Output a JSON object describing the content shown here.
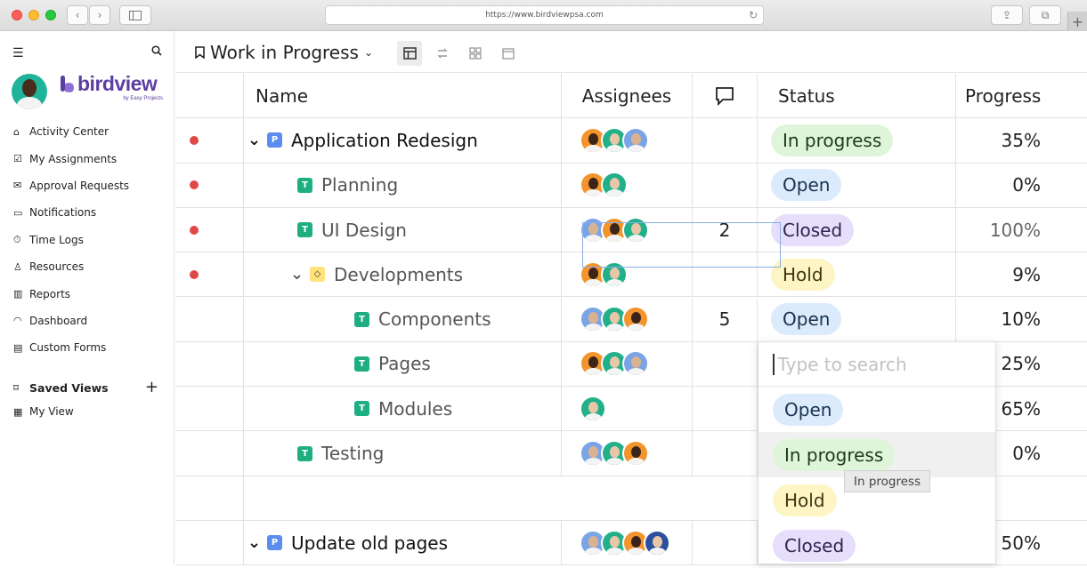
{
  "browser": {
    "url": "https://www.birdviewpsa.com",
    "back_glyph": "‹",
    "forward_glyph": "›",
    "reload_glyph": "↻",
    "share_glyph": "⇪",
    "tabs_glyph": "⧉",
    "new_tab_glyph": "+"
  },
  "brand": {
    "name": "birdview",
    "subtitle": "by Easy Projects",
    "color": "#5b3fa0"
  },
  "sidebar": {
    "items": [
      {
        "label": "Activity Center",
        "icon": "home-icon",
        "glyph": "⌂"
      },
      {
        "label": "My Assignments",
        "icon": "checkbox-icon",
        "glyph": "☑"
      },
      {
        "label": "Approval Requests",
        "icon": "approval-icon",
        "glyph": "✉"
      },
      {
        "label": "Notifications",
        "icon": "comment-icon",
        "glyph": "▭"
      },
      {
        "label": "Time Logs",
        "icon": "stopwatch-icon",
        "glyph": "⏱"
      },
      {
        "label": "Resources",
        "icon": "person-icon",
        "glyph": "♙"
      },
      {
        "label": "Reports",
        "icon": "bar-chart-icon",
        "glyph": "▥"
      },
      {
        "label": "Dashboard",
        "icon": "gauge-icon",
        "glyph": "◠"
      },
      {
        "label": "Custom Forms",
        "icon": "forms-icon",
        "glyph": "▤"
      }
    ],
    "saved_views_label": "Saved Views",
    "my_view_label": "My View"
  },
  "toolbar": {
    "view_title": "Work in Progress"
  },
  "columns": {
    "name": "Name",
    "assignees": "Assignees",
    "status": "Status",
    "progress": "Progress"
  },
  "rows": [
    {
      "dot": true,
      "indent": 0,
      "chevron": "down",
      "badge": "P",
      "name": "Application Redesign",
      "avatars": [
        "orange",
        "teal",
        "blue"
      ],
      "comments": "",
      "status": "In progress",
      "progress": "35%"
    },
    {
      "dot": true,
      "indent": 1,
      "chevron": "",
      "badge": "T",
      "name": "Planning",
      "avatars": [
        "orange",
        "teal"
      ],
      "comments": "",
      "status": "Open",
      "progress": "0%"
    },
    {
      "dot": true,
      "indent": 1,
      "chevron": "",
      "badge": "T",
      "name": "UI Design",
      "avatars": [
        "blue",
        "orange",
        "teal"
      ],
      "comments": "2",
      "status": "Closed",
      "progress": "100%"
    },
    {
      "dot": true,
      "indent": 1,
      "chevron": "down",
      "badge": "M",
      "name": "Developments",
      "avatars": [
        "orange",
        "teal"
      ],
      "comments": "",
      "status": "Hold",
      "progress": "9%"
    },
    {
      "dot": false,
      "indent": 2,
      "chevron": "",
      "badge": "T",
      "name": "Components",
      "avatars": [
        "blue",
        "teal",
        "orange"
      ],
      "comments": "5",
      "status": "Open",
      "progress": "10%"
    },
    {
      "dot": false,
      "indent": 2,
      "chevron": "",
      "badge": "T",
      "name": "Pages",
      "avatars": [
        "orange",
        "teal",
        "blue"
      ],
      "comments": "",
      "status": "",
      "progress": "25%"
    },
    {
      "dot": false,
      "indent": 2,
      "chevron": "",
      "badge": "T",
      "name": "Modules",
      "avatars": [
        "teal"
      ],
      "comments": "",
      "status": "",
      "progress": "65%"
    },
    {
      "dot": false,
      "indent": 1,
      "chevron": "",
      "badge": "T",
      "name": "Testing",
      "avatars": [
        "blue",
        "teal",
        "orange"
      ],
      "comments": "",
      "status": "",
      "progress": "0%"
    },
    {
      "dot": false,
      "indent": 0,
      "chevron": "",
      "badge": "",
      "name": "",
      "avatars": [],
      "comments": "",
      "status": "",
      "progress": ""
    },
    {
      "dot": false,
      "indent": 0,
      "chevron": "down",
      "badge": "P",
      "name": "Update old pages",
      "avatars": [
        "blue",
        "teal",
        "orange",
        "navy"
      ],
      "comments": "",
      "status": "",
      "progress": "50%"
    }
  ],
  "status_colors": {
    "In progress": {
      "bg": "#dff5da",
      "fg": "#1d3a1a"
    },
    "Open": {
      "bg": "#dcebfb",
      "fg": "#17324f"
    },
    "Closed": {
      "bg": "#e6defa",
      "fg": "#2d2450"
    },
    "Hold": {
      "bg": "#fdf5c4",
      "fg": "#3f3612"
    }
  },
  "avatar_colors": {
    "orange": {
      "bg": "#f4942c",
      "face": "#3b2418"
    },
    "teal": {
      "bg": "#21b08a",
      "face": "#e8c7a8"
    },
    "blue": {
      "bg": "#7aa4e6",
      "face": "#d9b391"
    },
    "navy": {
      "bg": "#2c4f9e",
      "face": "#e8c7a8"
    }
  },
  "dropdown": {
    "placeholder": "Type to search",
    "options": [
      "Open",
      "In progress",
      "Hold",
      "Closed"
    ],
    "hovered": "In progress",
    "tooltip": "In progress"
  }
}
